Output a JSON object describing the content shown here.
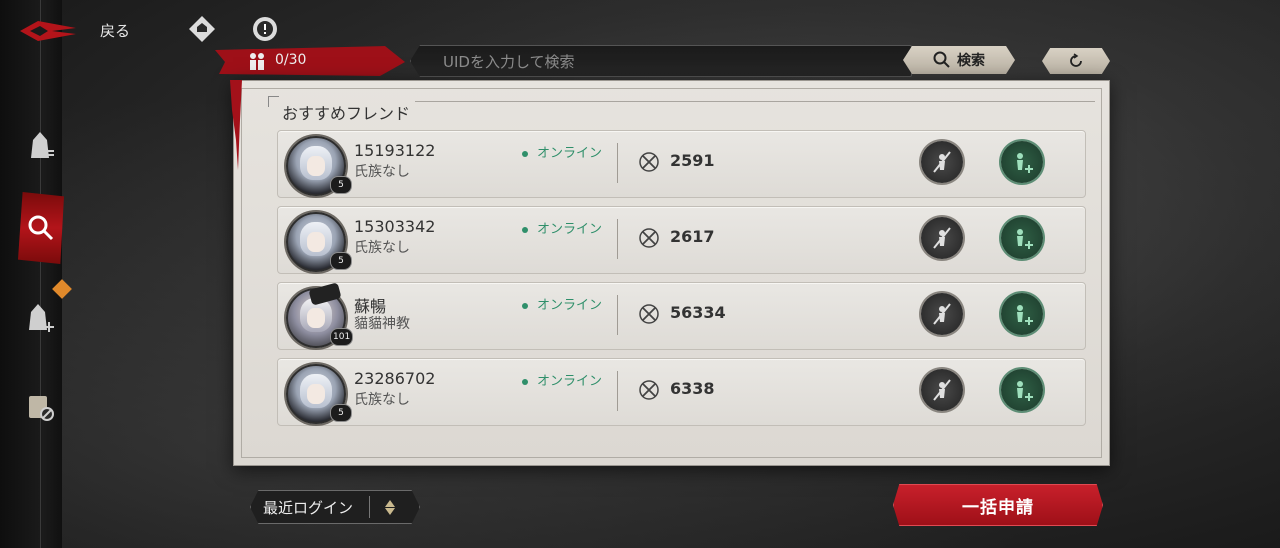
{
  "topbar": {
    "back_label": "戻る",
    "capacity_text": "0/30",
    "search_placeholder": "UIDを入力して検索",
    "search_button_label": "検索"
  },
  "panel": {
    "title": "おすすめフレンド"
  },
  "friends": [
    {
      "uid": "15193122",
      "clan": "氏族なし",
      "status": "オンライン",
      "power": "2591",
      "level": "5"
    },
    {
      "uid": "15303342",
      "clan": "氏族なし",
      "status": "オンライン",
      "power": "2617",
      "level": "5"
    },
    {
      "uid": "蘇暢",
      "clan": "貓貓神教",
      "status": "オンライン",
      "power": "56334",
      "level": "101"
    },
    {
      "uid": "23286702",
      "clan": "氏族なし",
      "status": "オンライン",
      "power": "6338",
      "level": "5"
    }
  ],
  "bottom": {
    "sort_label": "最近ログイン",
    "apply_all_label": "一括申請"
  },
  "colors": {
    "accent_red": "#b3141a",
    "online_green": "#2f8f6a",
    "panel_bg": "#e6e3de"
  }
}
